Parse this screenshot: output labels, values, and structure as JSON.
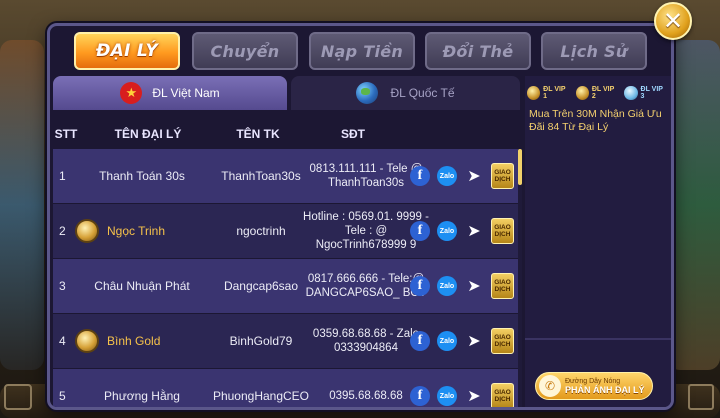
{
  "tabs": [
    {
      "label": "ĐẠI LÝ",
      "active": true
    },
    {
      "label": "Chuyển",
      "active": false
    },
    {
      "label": "Nạp Tiền",
      "active": false
    },
    {
      "label": "Đổi Thẻ",
      "active": false
    },
    {
      "label": "Lịch Sử",
      "active": false
    }
  ],
  "regions": {
    "vn_label": "ĐL Việt Nam",
    "intl_label": "ĐL Quốc Tế"
  },
  "table": {
    "headers": {
      "stt": "STT",
      "name": "TÊN ĐẠI LÝ",
      "tk": "TÊN TK",
      "sdt": "SĐT"
    },
    "rows": [
      {
        "stt": "1",
        "name": "Thanh Toán 30s",
        "tk": "ThanhToan30s",
        "sdt": "0813.111.111 - Tele @ ThanhToan30s",
        "medal": false
      },
      {
        "stt": "2",
        "name": "Ngọc Trinh",
        "tk": "ngoctrinh",
        "sdt": "Hotline : 0569.01. 9999 - Tele : @ NgocTrinh678999 9",
        "medal": true
      },
      {
        "stt": "3",
        "name": "Châu Nhuận Phát",
        "tk": "Dangcap6sao",
        "sdt": "0817.666.666 - Tele:@ DANGCAP6SAO_ BOT",
        "medal": false
      },
      {
        "stt": "4",
        "name": "Bình Gold",
        "tk": "BinhGold79",
        "sdt": "0359.68.68.68 - Zalo 0333904864",
        "medal": true
      },
      {
        "stt": "5",
        "name": "Phương Hằng",
        "tk": "PhuongHangCEO",
        "sdt": "0395.68.68.68",
        "medal": false
      }
    ],
    "action_labels": {
      "facebook": "f",
      "zalo": "Zalo",
      "telegram": "➤",
      "giao_dich": "GIAO DỊCH"
    }
  },
  "vip": [
    {
      "label": "ĐL VIP 1"
    },
    {
      "label": "ĐL VIP 2"
    },
    {
      "label": "ĐL VIP 3"
    }
  ],
  "promo_text": "Mua Trên 30M Nhận Giá Ưu Đãi 84 Từ Đại Lý",
  "hotline": {
    "small": "Đường Dây Nóng",
    "big": "PHẢN ÁNH ĐẠI LÝ"
  },
  "close_label": "✕",
  "colors": {
    "accent": "#ff9a1f",
    "panel": "#1c1733",
    "gold_text": "#f6c24a"
  }
}
